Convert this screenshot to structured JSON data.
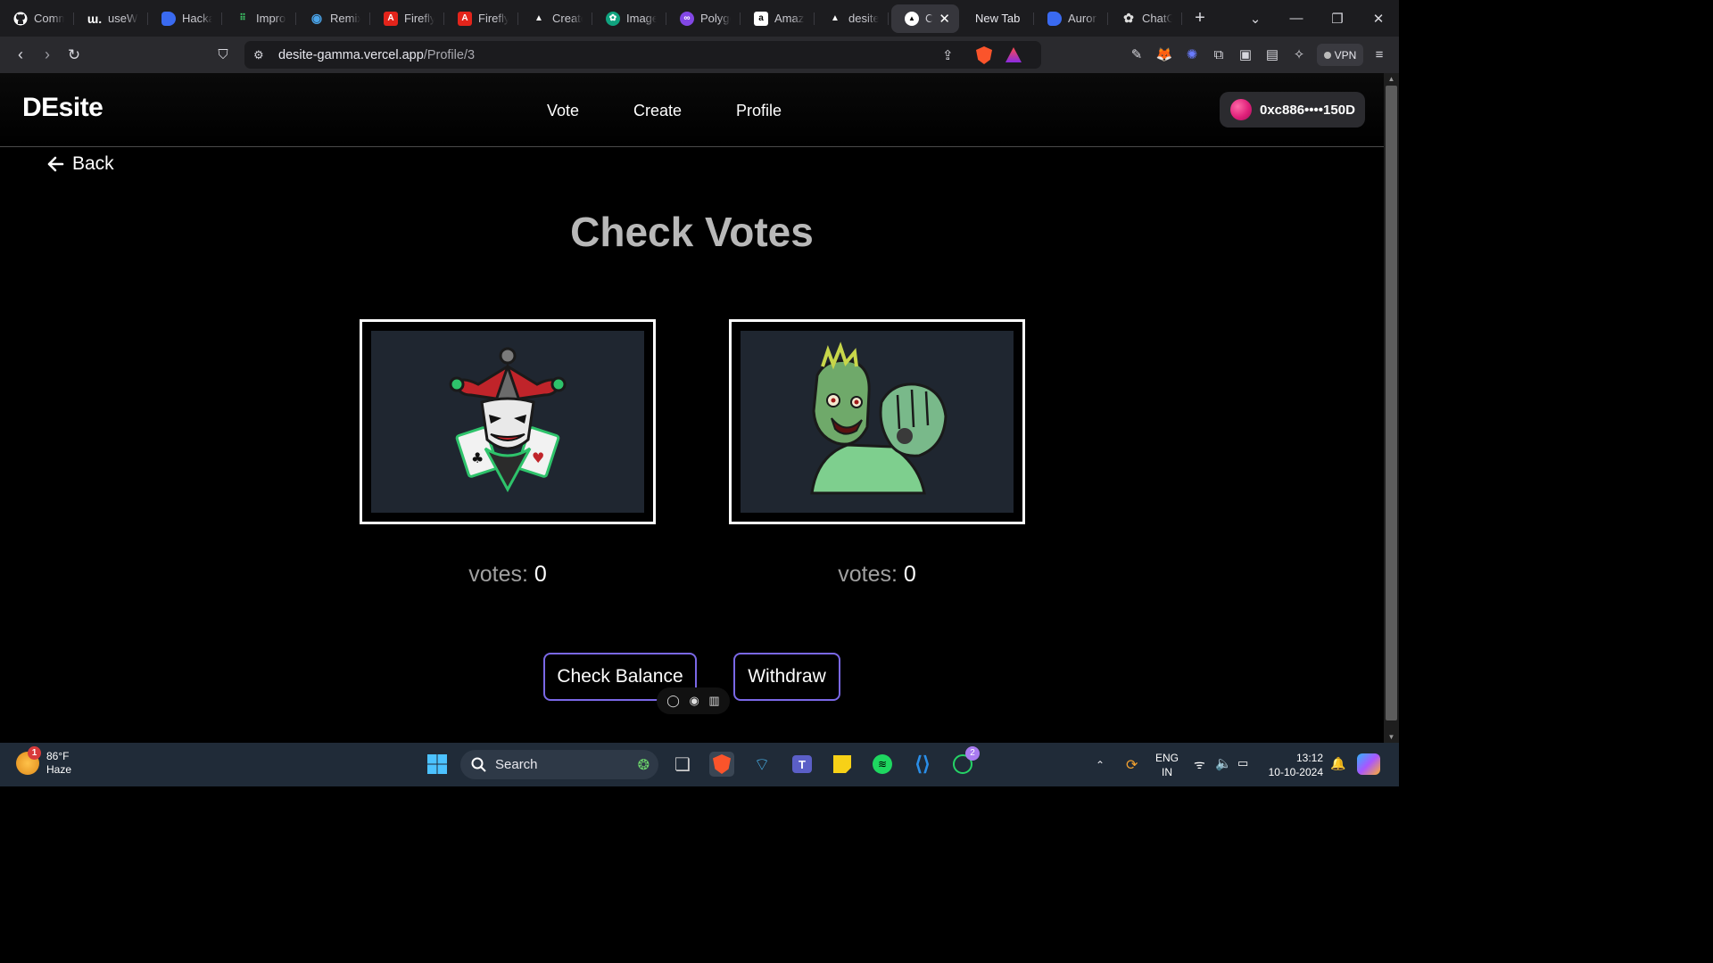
{
  "browser": {
    "tabs": [
      {
        "label": "Comm",
        "icon": "github-icon"
      },
      {
        "label": "useW",
        "icon": "wagmi-icon"
      },
      {
        "label": "Hacka",
        "icon": "blue-shield-icon"
      },
      {
        "label": "Impro",
        "icon": "dots-grid-icon"
      },
      {
        "label": "Remix",
        "icon": "remix-icon"
      },
      {
        "label": "Firefly",
        "icon": "adobe-icon"
      },
      {
        "label": "Firefly",
        "icon": "adobe-icon"
      },
      {
        "label": "Create",
        "icon": "triangle-icon"
      },
      {
        "label": "Image",
        "icon": "openai-icon"
      },
      {
        "label": "Polygo",
        "icon": "polygon-icon"
      },
      {
        "label": "Amazo",
        "icon": "amazon-icon"
      },
      {
        "label": "desite",
        "icon": "vercel-icon"
      },
      {
        "label": "C",
        "icon": "vercel-icon",
        "active": true
      },
      {
        "label": "New Tab",
        "icon": ""
      },
      {
        "label": "Auror",
        "icon": "blue-shield-icon"
      },
      {
        "label": "ChatG",
        "icon": "openai-icon"
      }
    ],
    "url_host": "desite-gamma.vercel.app",
    "url_path": "/Profile/3",
    "vpn_label": "VPN"
  },
  "site": {
    "logo": "DEsite",
    "nav": [
      "Vote",
      "Create",
      "Profile"
    ],
    "wallet": "0xc886••••150D",
    "back_label": "Back",
    "title": "Check Votes",
    "candidates": [
      {
        "image": "joker-jester-mascot",
        "votes_label": "votes:",
        "votes": "0"
      },
      {
        "image": "zombie-mascot",
        "votes_label": "votes:",
        "votes": "0"
      }
    ],
    "buttons": {
      "check_balance": "Check Balance",
      "withdraw": "Withdraw"
    }
  },
  "taskbar": {
    "weather_temp": "86°F",
    "weather_desc": "Haze",
    "weather_badge": "1",
    "search_placeholder": "Search",
    "whatsapp_badge": "2",
    "lang_line1": "ENG",
    "lang_line2": "IN",
    "time": "13:12",
    "date": "10-10-2024"
  },
  "colors": {
    "page_bg": "#000000",
    "button_border": "#7a68e6",
    "title_gray": "#b8b8b8",
    "taskbar_bg": "#202b38"
  }
}
